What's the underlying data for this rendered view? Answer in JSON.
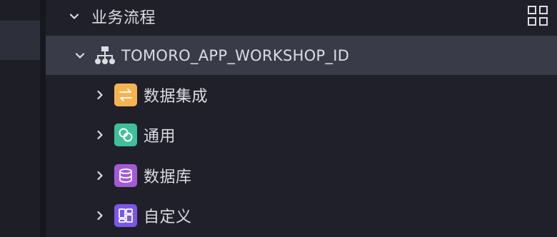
{
  "tree": {
    "root": {
      "label": "业务流程",
      "expanded": true
    },
    "project": {
      "label": "TOMORO_APP_WORKSHOP_ID",
      "expanded": true
    },
    "categories": [
      {
        "label": "数据集成",
        "icon": "data-integration-icon",
        "color": "#f5b452"
      },
      {
        "label": "通用",
        "icon": "general-icon",
        "color": "#3fbf9a"
      },
      {
        "label": "数据库",
        "icon": "database-icon",
        "color": "#a45ad6"
      },
      {
        "label": "自定义",
        "icon": "custom-icon",
        "color": "#7b57e8"
      }
    ]
  },
  "toolbar": {
    "layout_icon": "grid-icon"
  },
  "colors": {
    "background": "#1f2029",
    "selected_row": "#3a3b49",
    "text": "#dcdde3"
  }
}
